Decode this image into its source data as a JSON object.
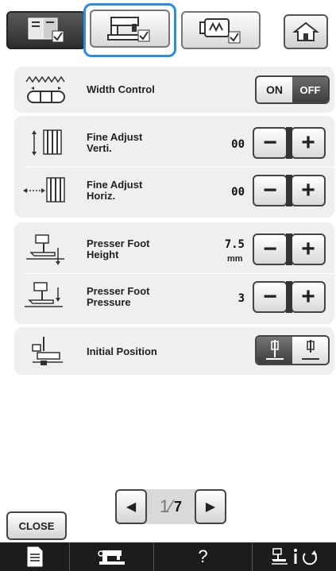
{
  "tabs": [
    {
      "name": "settings-page-tab",
      "selected": false
    },
    {
      "name": "machine-settings-tab",
      "selected": true
    },
    {
      "name": "embroidery-settings-tab",
      "selected": false
    }
  ],
  "home_icon": "home-icon",
  "width_control": {
    "label": "Width Control",
    "on_label": "ON",
    "off_label": "OFF",
    "state": "OFF"
  },
  "fine_adjust_verti": {
    "label_line1": "Fine Adjust",
    "label_line2": "Verti.",
    "value": "00"
  },
  "fine_adjust_horiz": {
    "label_line1": "Fine Adjust",
    "label_line2": "Horiz.",
    "value": "00"
  },
  "presser_foot_height": {
    "label_line1": "Presser Foot",
    "label_line2": "Height",
    "value": "7.5",
    "unit": "mm"
  },
  "presser_foot_pressure": {
    "label_line1": "Presser Foot",
    "label_line2": "Pressure",
    "value": "3"
  },
  "initial_position": {
    "label": "Initial Position"
  },
  "stepper": {
    "minus": "−",
    "plus": "+"
  },
  "pager": {
    "prev": "◀",
    "next": "▶",
    "current": "1",
    "slash": "⁄",
    "total": "7"
  },
  "close_label": "CLOSE",
  "bottom_bar": {
    "help": "?"
  },
  "colors": {
    "accent": "#2d8be8",
    "panel": "#efefef",
    "bottom_bar": "#1c1c1c"
  }
}
